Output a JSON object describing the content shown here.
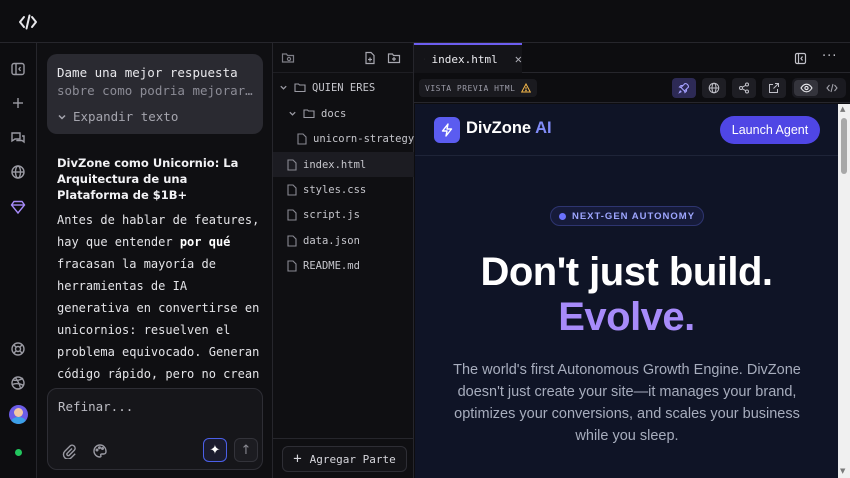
{
  "chat": {
    "prompt_line1": "Dame una mejor respuesta",
    "prompt_line2": "sobre como podria mejorar…",
    "expand_label": "Expandir texto",
    "response_title": "DivZone como Unicornio: La Arquitectura de una Plataforma de $1B+",
    "response_body": [
      {
        "text": "Antes de hablar de features, hay que entender ",
        "bold": false
      },
      {
        "text": "por qué",
        "bold": true
      },
      {
        "text": " fracasan la mayoría de herramientas de IA generativa en convertirse en unicornios: resuelven el problema equivocado. Generan código rápido, pero no crean",
        "bold": false
      }
    ],
    "refine_placeholder": "Refinar..."
  },
  "tree": {
    "items": [
      {
        "label": "QUIEN ERES",
        "type": "folder-open"
      },
      {
        "label": "docs",
        "type": "folder"
      },
      {
        "label": "unicorn-strategy.md",
        "type": "file"
      },
      {
        "label": "index.html",
        "type": "file",
        "active": true
      },
      {
        "label": "styles.css",
        "type": "file"
      },
      {
        "label": "script.js",
        "type": "file"
      },
      {
        "label": "data.json",
        "type": "file"
      },
      {
        "label": "README.md",
        "type": "file"
      }
    ],
    "add_part_label": "Agregar Parte"
  },
  "preview": {
    "tab_label": "index.html",
    "vista_label": "VISTA PREVIA HTML",
    "site": {
      "brand": "DivZone",
      "brand_accent": "AI",
      "cta": "Launch Agent",
      "badge": "NEXT-GEN AUTONOMY",
      "headline_1": "Don't just build.",
      "headline_2": "Evolve.",
      "description": "The world's first Autonomous Growth Engine. DivZone doesn't just create your site—it manages your brand, optimizes your conversions, and scales your business while you sleep."
    }
  },
  "colors": {
    "accent": "#4f46e5",
    "headline_accent": "#a78bfa",
    "status_online": "#22c55e"
  }
}
